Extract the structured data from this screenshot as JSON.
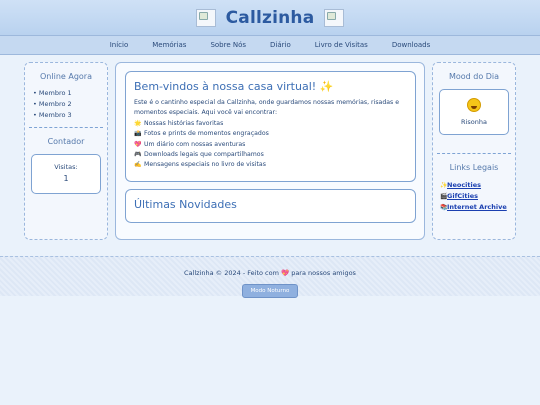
{
  "header": {
    "title": "Callzinha"
  },
  "nav": {
    "items": [
      "Início",
      "Memórias",
      "Sobre Nós",
      "Diário",
      "Livro de Visitas",
      "Downloads"
    ]
  },
  "left_sidebar": {
    "online_title": "Online Agora",
    "members": [
      "Membro 1",
      "Membro 2",
      "Membro 3"
    ],
    "counter_title": "Contador",
    "visits_label": "Visitas:",
    "visits_value": "1"
  },
  "main": {
    "welcome_title": "Bem-vindos à nossa casa virtual! ✨",
    "intro": "Este é o cantinho especial da Callzinha, onde guardamos nossas memórias, risadas e momentos especiais. Aqui você vai encontrar:",
    "features": [
      {
        "icon": "star-icon",
        "text": "Nossas histórias favoritas"
      },
      {
        "icon": "camera-icon",
        "text": "Fotos e prints de momentos engraçados"
      },
      {
        "icon": "heart-icon",
        "text": "Um diário com nossas aventuras"
      },
      {
        "icon": "gamepad-icon",
        "text": "Downloads legais que compartilhamos"
      },
      {
        "icon": "writing-hand-icon",
        "text": "Mensagens especiais no livro de visitas"
      }
    ],
    "news_title": "Últimas Novidades"
  },
  "right_sidebar": {
    "mood_title": "Mood do Dia",
    "mood_icon": "rofl-emoji-icon",
    "mood_text": "Risonha",
    "links_title": "Links Legais",
    "links": [
      {
        "icon": "sparkles-icon",
        "label": "Neocities"
      },
      {
        "icon": "clapper-icon",
        "label": "GifCities"
      },
      {
        "icon": "books-icon",
        "label": "Internet Archive"
      }
    ]
  },
  "footer": {
    "text_before": "Callzinha © 2024 - Feito com",
    "text_after": "para nossos amigos",
    "mode_button": "Modo Noturno"
  }
}
